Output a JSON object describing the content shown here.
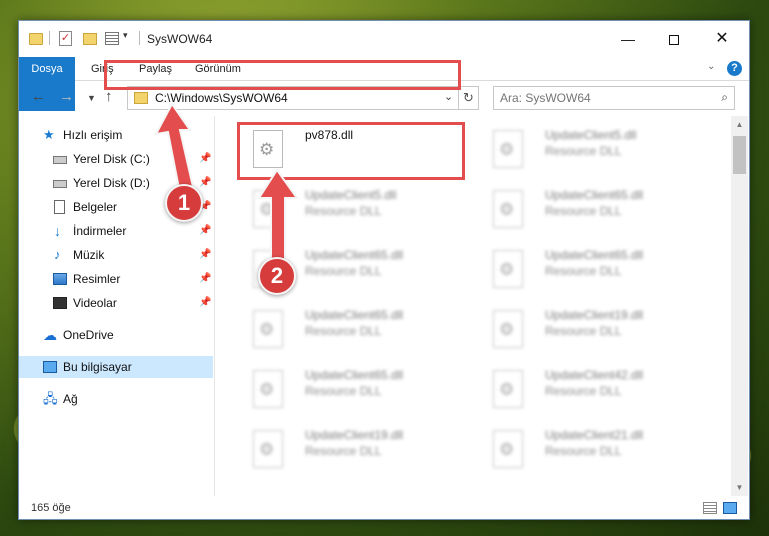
{
  "window": {
    "title": "SysWOW64",
    "minimize_glyph": "—",
    "close_glyph": "✕"
  },
  "ribbon": {
    "tabs": [
      "Dosya",
      "Giriş",
      "Paylaş",
      "Görünüm"
    ],
    "help_glyph": "?"
  },
  "address": {
    "path": "C:\\Windows\\SysWOW64",
    "refresh_glyph": "↻"
  },
  "search": {
    "placeholder": "Ara: SysWOW64"
  },
  "nav": {
    "items": [
      {
        "label": "Hızlı erişim",
        "icon": "star-icon"
      },
      {
        "label": "Yerel Disk (C:)",
        "icon": "disk-icon",
        "pinned": true
      },
      {
        "label": "Yerel Disk (D:)",
        "icon": "disk-icon",
        "pinned": true
      },
      {
        "label": "Belgeler",
        "icon": "documents-icon",
        "pinned": true
      },
      {
        "label": "İndirmeler",
        "icon": "downloads-icon",
        "pinned": true
      },
      {
        "label": "Müzik",
        "icon": "music-icon",
        "pinned": true
      },
      {
        "label": "Resimler",
        "icon": "pictures-icon",
        "pinned": true
      },
      {
        "label": "Videolar",
        "icon": "videos-icon",
        "pinned": true
      },
      {
        "label": "OneDrive",
        "icon": "onedrive-icon"
      },
      {
        "label": "Bu bilgisayar",
        "icon": "this-pc-icon",
        "selected": true
      },
      {
        "label": "Ağ",
        "icon": "network-icon"
      }
    ]
  },
  "files": [
    {
      "name": "pv878.dll",
      "type": ""
    },
    {
      "name": "UpdateClient5.dll",
      "type": "Resource DLL"
    },
    {
      "name": "UpdateClient5.dll",
      "type": "Resource DLL"
    },
    {
      "name": "UpdateClient65.dll",
      "type": "Resource DLL"
    },
    {
      "name": "UpdateClient65.dll",
      "type": "Resource DLL"
    },
    {
      "name": "UpdateClient65.dll",
      "type": "Resource DLL"
    },
    {
      "name": "UpdateClient65.dll",
      "type": "Resource DLL"
    },
    {
      "name": "UpdateClient19.dll",
      "type": "Resource DLL"
    },
    {
      "name": "UpdateClient65.dll",
      "type": "Resource DLL"
    },
    {
      "name": "UpdateClient42.dll",
      "type": "Resource DLL"
    },
    {
      "name": "UpdateClient19.dll",
      "type": "Resource DLL"
    },
    {
      "name": "UpdateClient21.dll",
      "type": "Resource DLL"
    }
  ],
  "status": {
    "count": "165 öğe"
  },
  "annotations": {
    "badge1": "1",
    "badge2": "2",
    "color": "#e44d4d"
  }
}
